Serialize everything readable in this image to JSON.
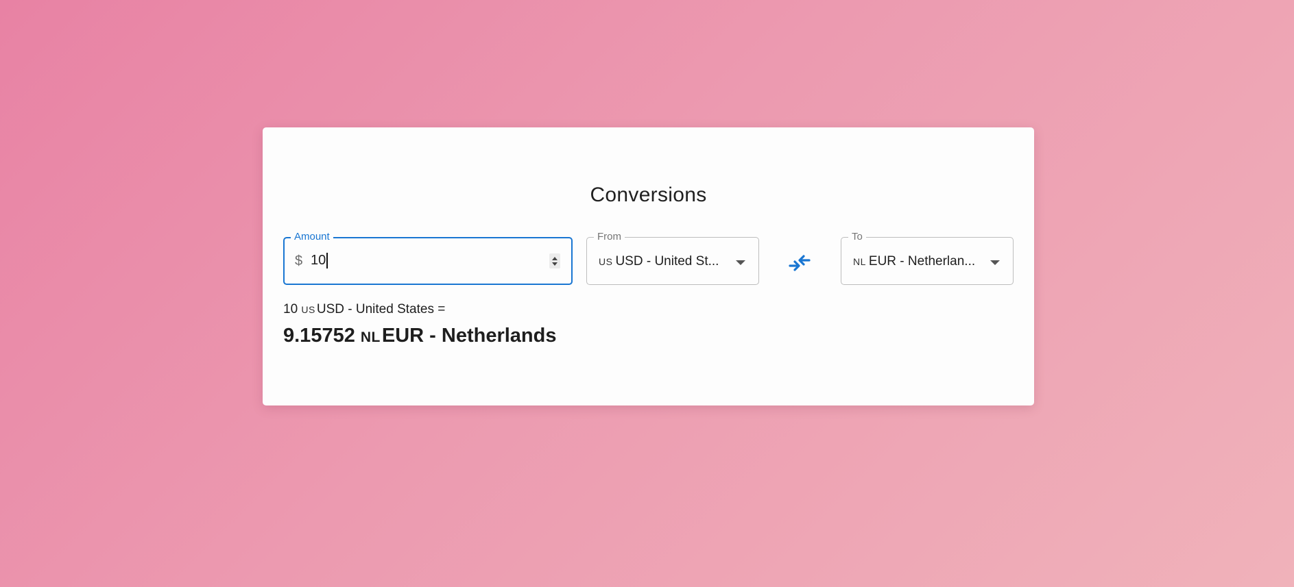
{
  "card": {
    "title": "Conversions"
  },
  "amount": {
    "label": "Amount",
    "prefix": "$",
    "value": "10"
  },
  "from": {
    "label": "From",
    "flag": "US",
    "value": "USD - United States",
    "display": "USD - United St..."
  },
  "to": {
    "label": "To",
    "flag": "NL",
    "value": "EUR - Netherlands",
    "display": "EUR - Netherlan..."
  },
  "swap": {
    "icon": "swap-arrows-icon",
    "color": "#1976d2"
  },
  "result": {
    "amount": "10",
    "from_flag": "US",
    "from_currency": "USD - United States",
    "equals": "=",
    "converted": "9.15752",
    "to_flag": "NL",
    "to_currency": "EUR - Netherlands"
  },
  "colors": {
    "accent": "#1976d2",
    "background_start": "#e882a4",
    "background_end": "#f0b2ba",
    "card": "#fdfdfd"
  }
}
